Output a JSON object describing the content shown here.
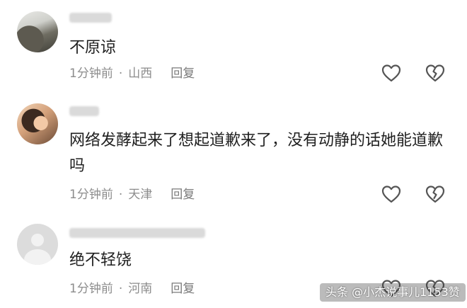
{
  "comments": [
    {
      "username": "▇▇▇▇",
      "content": "不原谅",
      "time": "1分钟前",
      "location": "山西",
      "reply_label": "回复"
    },
    {
      "username": "▇▇▇",
      "content": "网络发酵起来了想起道歉来了，没有动静的话她能道歉吗",
      "time": "1分钟前",
      "location": "天津",
      "reply_label": "回复"
    },
    {
      "username": "▇▇▇▇▇▇▇▇▇▇▇▇▇▇",
      "content": "绝不轻饶",
      "time": "1分钟前",
      "location": "河南",
      "reply_label": "回复"
    }
  ],
  "meta_separator": "·",
  "watermark": "头条 @小杰说事儿1153赞",
  "icons": {
    "like": "heart-outline-icon",
    "dislike": "broken-heart-icon"
  }
}
